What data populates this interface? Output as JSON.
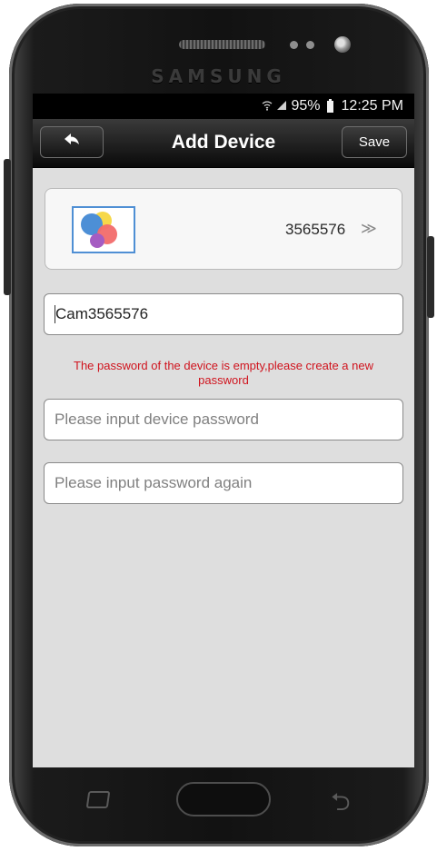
{
  "device_frame": {
    "brand": "SAMSUNG"
  },
  "status_bar": {
    "battery": "95%",
    "time": "12:25 PM",
    "icons": [
      "wifi-icon",
      "signal-icon",
      "battery-icon"
    ]
  },
  "header": {
    "title": "Add Device",
    "back_icon": "back-arrow-icon",
    "save_label": "Save"
  },
  "device_card": {
    "id": "3565576",
    "chevron": "≫",
    "thumbnail": "device-thumbnail-icon"
  },
  "form": {
    "name_value": "Cam3565576",
    "warning": "The password of the device is empty,please create a new password",
    "password_placeholder": "Please input device password",
    "password_again_placeholder": "Please input password again"
  },
  "nav_bar": {
    "icons": [
      "recent-apps-icon",
      "home-button",
      "back-icon"
    ]
  },
  "colors": {
    "screen_bg": "#dedede",
    "header_bg": "#1a1a1a",
    "warning": "#d0141e",
    "thumbnail_border": "#4f8fd4"
  }
}
